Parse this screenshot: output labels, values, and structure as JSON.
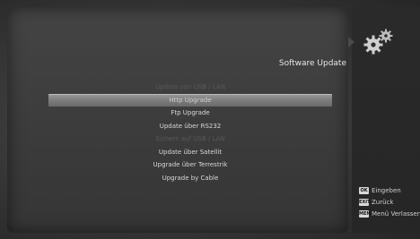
{
  "header": {
    "title": "Software Update"
  },
  "menu": {
    "items": [
      {
        "label": "Update von USB / LAN",
        "state": "disabled"
      },
      {
        "label": "Http Upgrade",
        "state": "selected"
      },
      {
        "label": "Ftp Upgrade",
        "state": "normal"
      },
      {
        "label": "Update über RS232",
        "state": "normal"
      },
      {
        "label": "Sichern auf USB / LAN",
        "state": "disabled"
      },
      {
        "label": "Update über Satellit",
        "state": "normal"
      },
      {
        "label": "Upgrade über Terrestrik",
        "state": "normal"
      },
      {
        "label": "Upgrade by Cable",
        "state": "normal"
      }
    ]
  },
  "legend": {
    "items": [
      {
        "key": "OK",
        "label": "Eingeben"
      },
      {
        "key": "EXIT",
        "label": "Zurück"
      },
      {
        "key": "MENU",
        "label": "Menü Verlassen"
      }
    ]
  },
  "icons": {
    "logo": "gears-icon"
  }
}
